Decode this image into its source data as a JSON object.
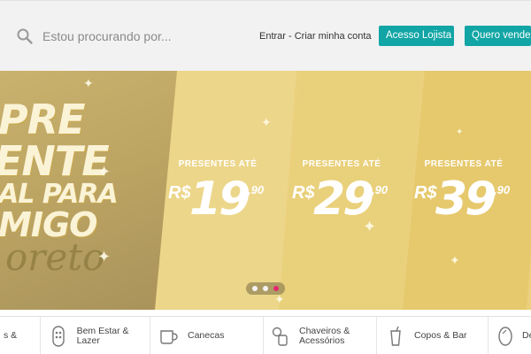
{
  "header": {
    "search_placeholder": "Estou procurando por...",
    "login_link": "Entrar - Criar minha conta",
    "btn_lojista": "Acesso Lojista",
    "btn_vender": "Quero vender I"
  },
  "banner": {
    "headline_lines": [
      "PRE",
      "ENTE",
      "AL PARA",
      "MIGO"
    ],
    "script_word": "oreto",
    "prices": [
      {
        "label": "PRESENTES ATÉ",
        "currency": "R$",
        "integer": "19",
        "cents": ",90"
      },
      {
        "label": "PRESENTES ATÉ",
        "currency": "R$",
        "integer": "29",
        "cents": ",90"
      },
      {
        "label": "PRESENTES ATÉ",
        "currency": "R$",
        "integer": "39",
        "cents": ",90"
      }
    ],
    "carousel": {
      "count": 3,
      "active_index": 3
    }
  },
  "categories": [
    {
      "label": "s &",
      "icon": "gift-icon"
    },
    {
      "label": "Bem Estar & Lazer",
      "icon": "wellness-icon"
    },
    {
      "label": "Canecas",
      "icon": "mug-icon"
    },
    {
      "label": "Chaveiros & Acessórios",
      "icon": "keychain-icon"
    },
    {
      "label": "Copos & Bar",
      "icon": "cup-icon"
    },
    {
      "label": "De Org",
      "icon": "mirror-icon"
    }
  ],
  "colors": {
    "accent_teal": "#12a5a5",
    "banner_gold": "#ebd07d",
    "carousel_active": "#e4286f"
  }
}
